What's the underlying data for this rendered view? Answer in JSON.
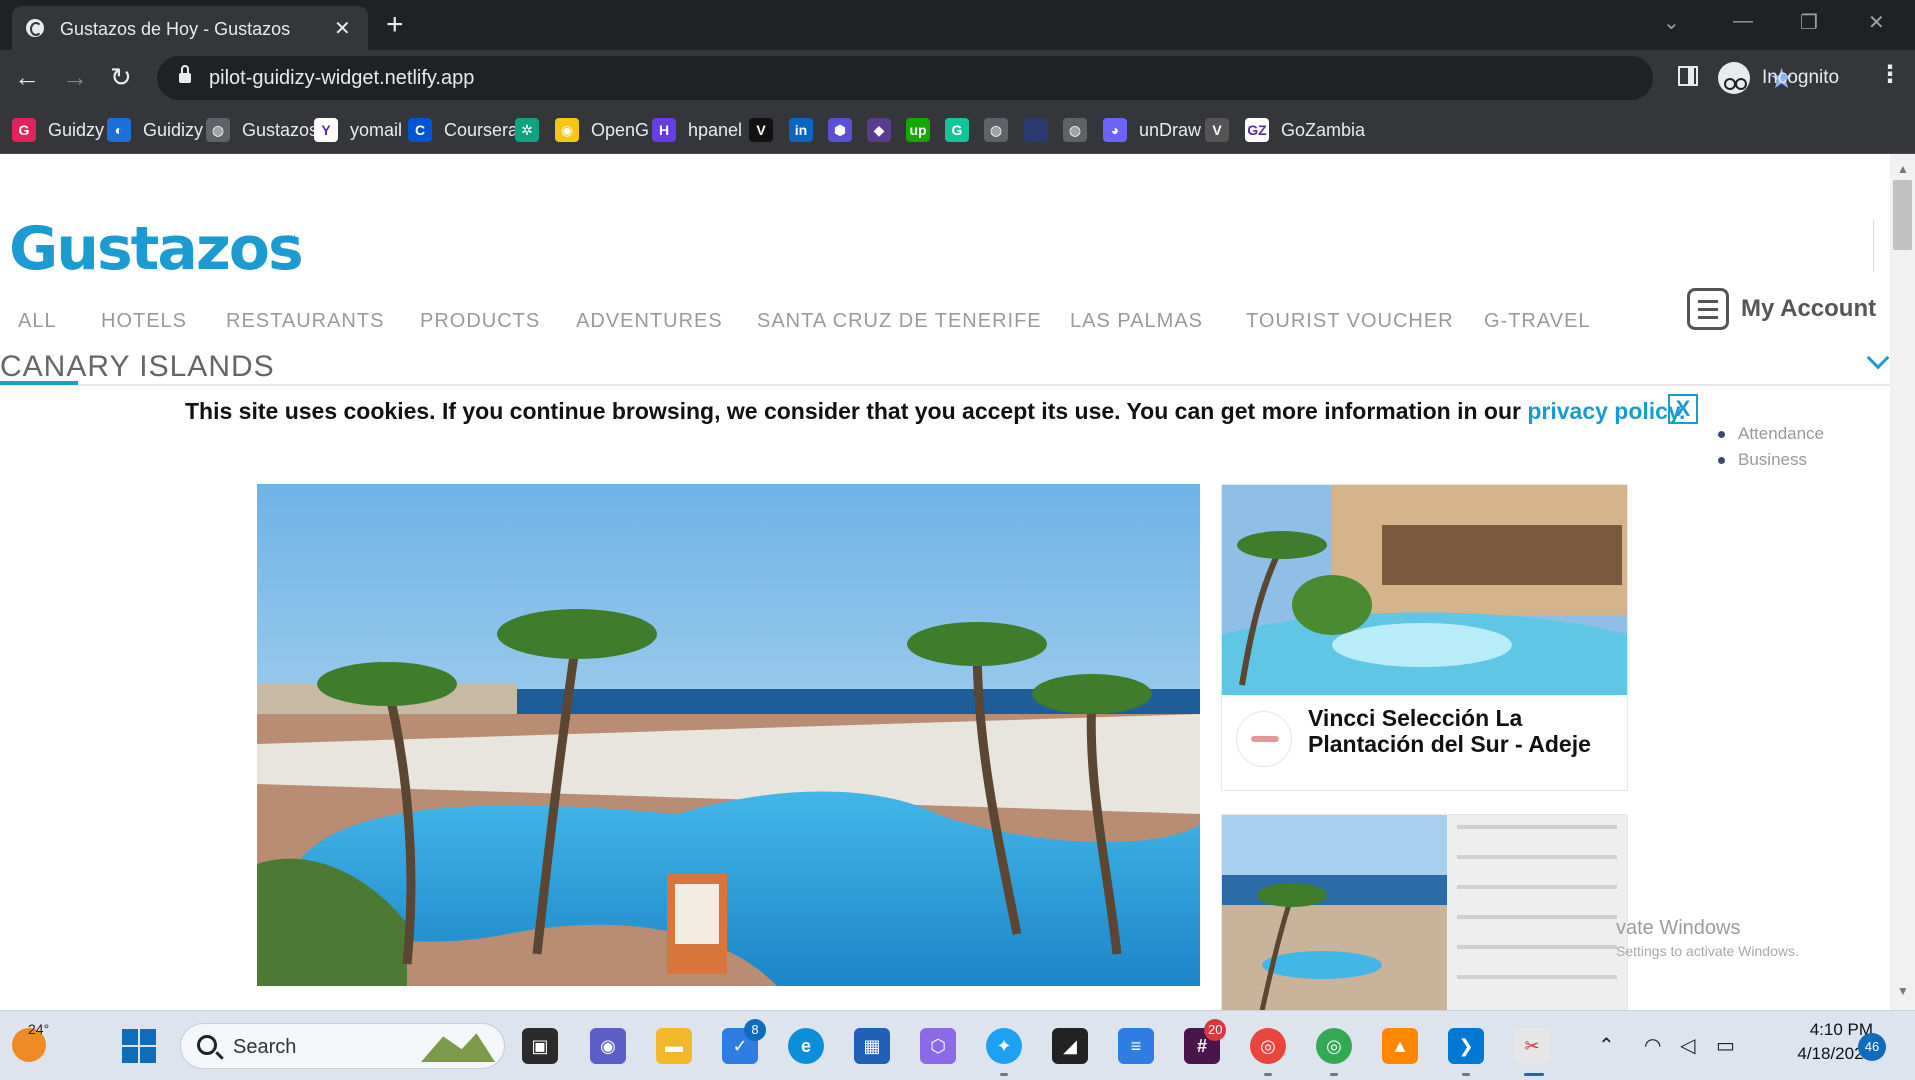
{
  "browser": {
    "tab_title": "Gustazos de Hoy - Gustazos",
    "tab_close": "✕",
    "new_tab": "+",
    "url": "pilot-guidizy-widget.netlify.app",
    "profile_label": "Incognito",
    "bookmarks": [
      {
        "label": "Guidzy",
        "icon": "guidzy-icon",
        "color": "#e0245e",
        "glyph": "G"
      },
      {
        "label": "Guidizy",
        "icon": "guidizy-icon",
        "color": "#1e6fd9",
        "glyph": "◐"
      },
      {
        "label": "Gustazos",
        "icon": "globe-icon",
        "color": "#5f6368",
        "glyph": "◍"
      },
      {
        "label": "yomail",
        "icon": "yahoo-icon",
        "color": "#ffffff",
        "glyph": "Y"
      },
      {
        "label": "Coursera",
        "icon": "coursera-icon",
        "color": "#0056d2",
        "glyph": "C"
      },
      {
        "label": "",
        "icon": "chatgpt-icon",
        "color": "#10a37f",
        "glyph": "✲"
      },
      {
        "label": "OpenG",
        "icon": "openg-icon",
        "color": "#f5c518",
        "glyph": "◉"
      },
      {
        "label": "hpanel",
        "icon": "hostinger-icon",
        "color": "#673de6",
        "glyph": "H"
      },
      {
        "label": "",
        "icon": "vimeo-icon",
        "color": "#111111",
        "glyph": "V"
      },
      {
        "label": "",
        "icon": "linkedin-icon",
        "color": "#0a66c2",
        "glyph": "in"
      },
      {
        "label": "",
        "icon": "hexagon-icon",
        "color": "#5b4fd6",
        "glyph": "⬢"
      },
      {
        "label": "",
        "icon": "game-icon",
        "color": "#5a3c8c",
        "glyph": "◆"
      },
      {
        "label": "",
        "icon": "upwork-icon",
        "color": "#14a800",
        "glyph": "up"
      },
      {
        "label": "",
        "icon": "grammarly-icon",
        "color": "#15c39a",
        "glyph": "G"
      },
      {
        "label": "",
        "icon": "globe-icon",
        "color": "#5f6368",
        "glyph": "◍"
      },
      {
        "label": "",
        "icon": "blank-icon",
        "color": "#2b3a70",
        "glyph": ""
      },
      {
        "label": "",
        "icon": "globe-icon",
        "color": "#5f6368",
        "glyph": "◍"
      },
      {
        "label": "unDraw",
        "icon": "undraw-icon",
        "color": "#6c63ff",
        "glyph": "◕"
      },
      {
        "label": "",
        "icon": "vue-icon",
        "color": "#555555",
        "glyph": "V"
      },
      {
        "label": "GoZambia",
        "icon": "gozambia-icon",
        "color": "#ffffff",
        "glyph": "GZ"
      }
    ]
  },
  "site": {
    "logo": "Gustazos",
    "logo_tm": "™",
    "account_label": "My Account",
    "nav": [
      "ALL",
      "HOTELS",
      "RESTAURANTS",
      "PRODUCTS",
      "ADVENTURES",
      "SANTA CRUZ DE TENERIFE",
      "LAS PALMAS",
      "TOURIST VOUCHER",
      "G-TRAVEL"
    ],
    "region_title": "CANARY ISLANDS",
    "cookie_text": "This site uses cookies. If you continue browsing, we consider that you accept its use. You can get more information in our ",
    "cookie_link": "privacy policy.",
    "cookie_close": "X",
    "side_menu": [
      "Attendance",
      "Business"
    ],
    "cards": [
      {
        "title": "Vincci Selección La Plantación del Sur - Adeje"
      }
    ],
    "watermark_title": "vate Windows",
    "watermark_sub": "Settings to activate Windows."
  },
  "taskbar": {
    "weather_temp": "24°",
    "search_label": "Search",
    "time": "4:10 PM",
    "date": "4/18/2023",
    "notifications": "46",
    "todo_badge": "8",
    "slack_badge": "20"
  },
  "colors": {
    "brand": "#1b9bd1",
    "chrome_dark": "#202124",
    "chrome_mid": "#35363a",
    "taskbar": "#dde4ee"
  }
}
